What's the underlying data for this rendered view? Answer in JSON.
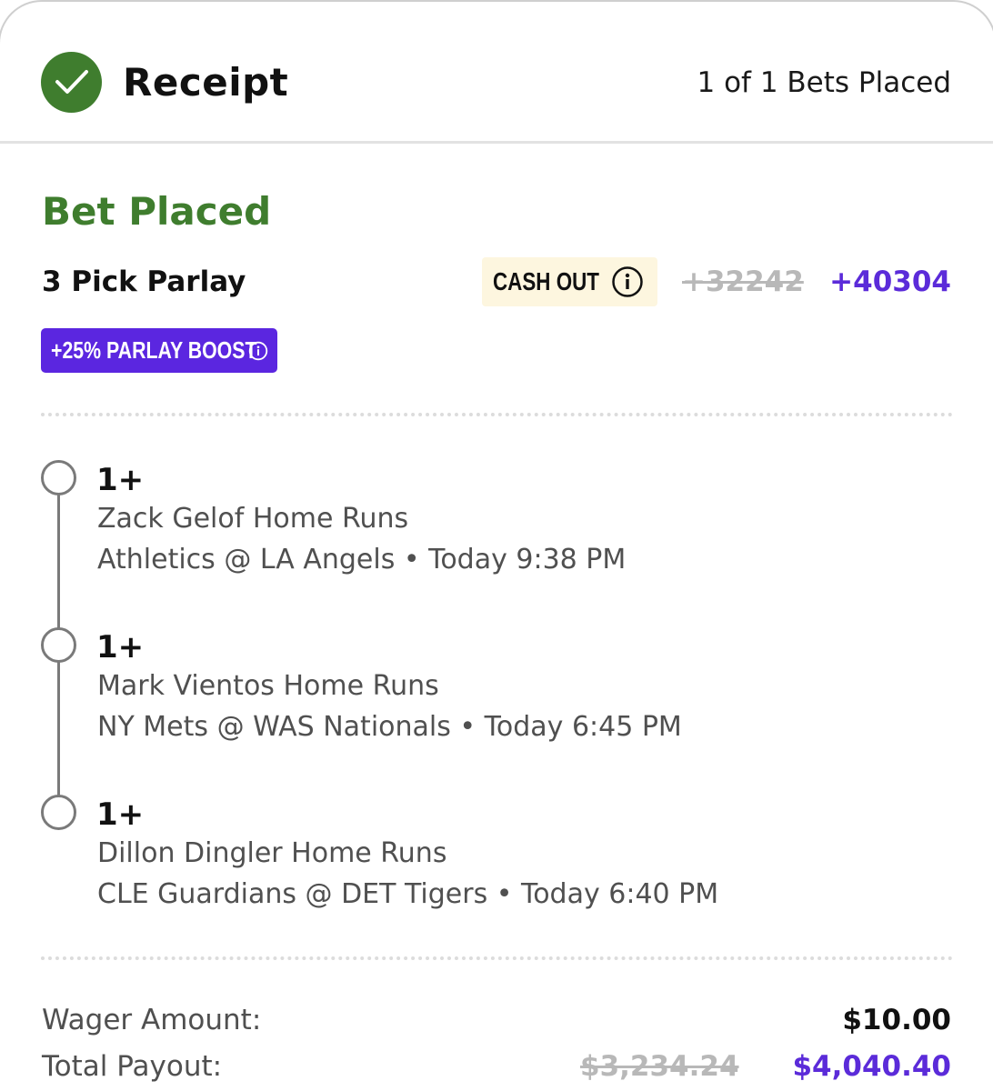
{
  "header": {
    "title": "Receipt",
    "bets_placed": "1 of 1 Bets Placed",
    "status_icon": "check-circle-icon"
  },
  "bet": {
    "status": "Bet Placed",
    "type": "3 Pick Parlay",
    "cash_out_label": "CASH OUT",
    "odds_original": "+32242",
    "odds_boosted": "+40304",
    "boost_label": "+25% PARLAY BOOST"
  },
  "legs": [
    {
      "line": "1+",
      "player": "Zack Gelof Home Runs",
      "game": "Athletics @ LA Angels • Today 9:38 PM"
    },
    {
      "line": "1+",
      "player": "Mark Vientos Home Runs",
      "game": "NY Mets @ WAS Nationals • Today 6:45 PM"
    },
    {
      "line": "1+",
      "player": "Dillon Dingler Home Runs",
      "game": "CLE Guardians @ DET Tigers • Today 6:40 PM"
    }
  ],
  "summary": {
    "wager_label": "Wager Amount:",
    "wager_value": "$10.00",
    "payout_label": "Total Payout:",
    "payout_original": "$3,234.24",
    "payout_boosted": "$4,040.40"
  },
  "colors": {
    "success_green": "#3f7d2e",
    "boost_purple": "#5b26e0",
    "odds_purple": "#5b2bd9",
    "cashout_bg": "#fdf6df"
  }
}
